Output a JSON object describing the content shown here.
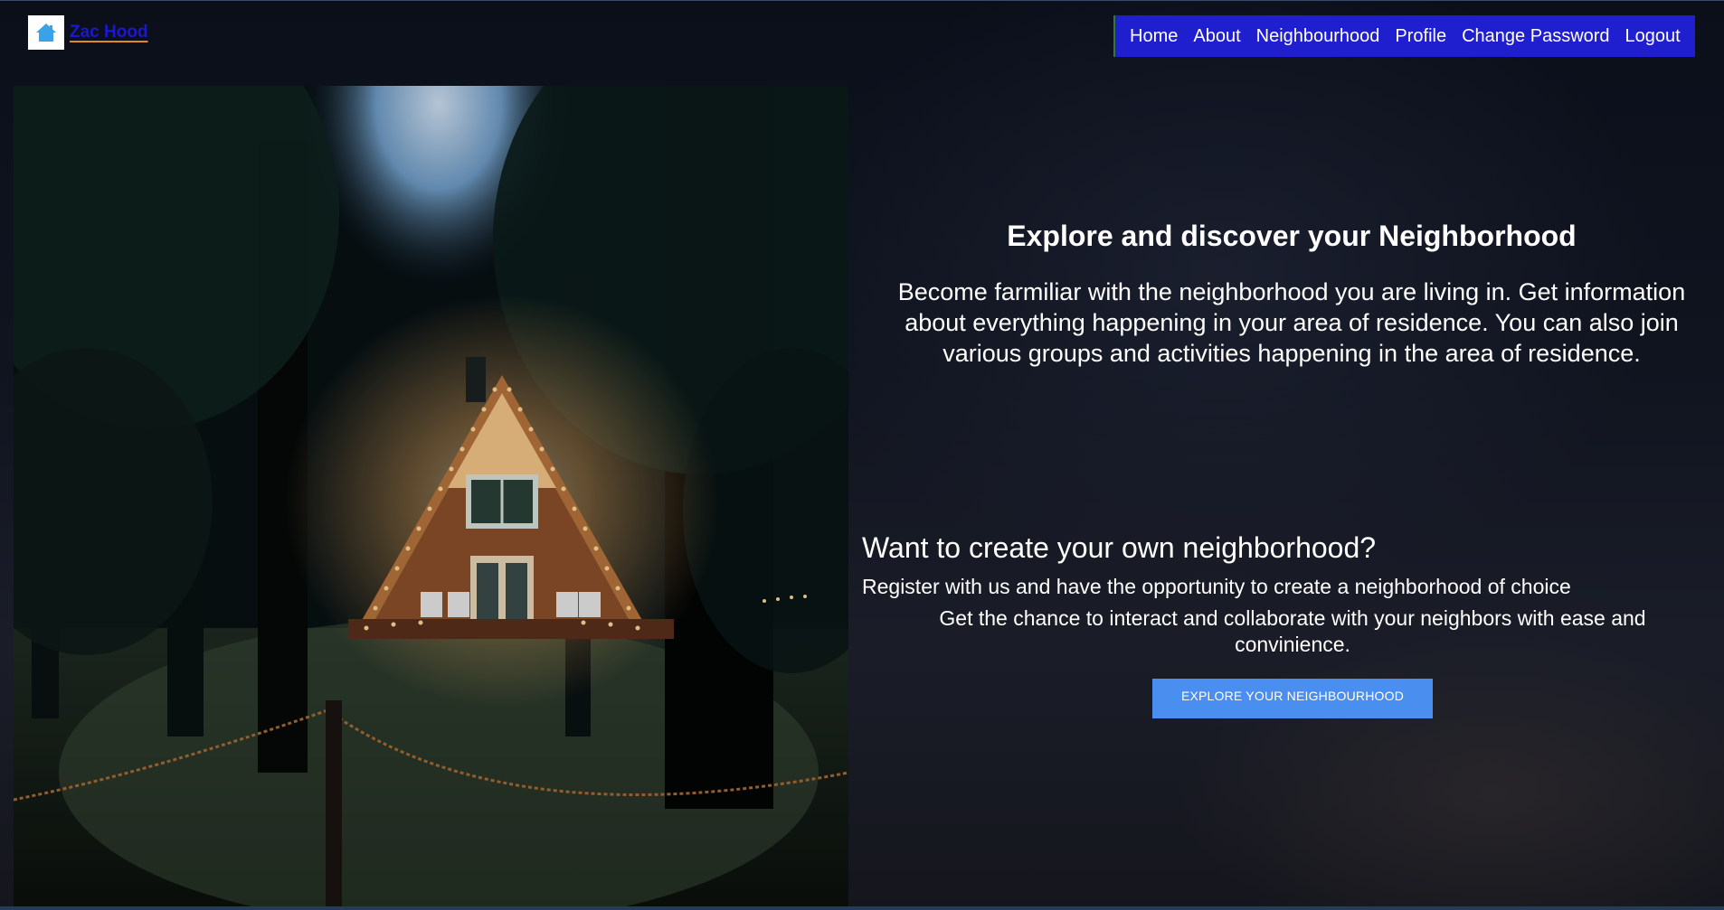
{
  "header": {
    "brand_name": "Zac Hood",
    "logo_icon": "house-icon"
  },
  "nav": {
    "items": [
      {
        "label": "Home"
      },
      {
        "label": "About"
      },
      {
        "label": "Neighbourhood"
      },
      {
        "label": "Profile"
      },
      {
        "label": "Change Password"
      },
      {
        "label": "Logout"
      }
    ]
  },
  "hero": {
    "headline": "Explore and discover your Neighborhood",
    "intro": "Become farmiliar with the neighborhood you are living in. Get information about everything happening in your area of residence. You can also join various groups and activities happening in the area of residence."
  },
  "cta": {
    "heading": "Want to create your own neighborhood?",
    "register_text": "Register with us and have the opportunity to create a neighborhood of choice",
    "interact_text": "Get the chance to interact and collaborate with your neighbors with ease and convinience.",
    "button_label": "EXPLORE YOUR NEIGHBOURHOOD"
  },
  "colors": {
    "nav_bg": "#1f1fcf",
    "brand_link": "#1a17d6",
    "brand_underline": "#e08b1f",
    "button_bg": "#4a8ef0",
    "page_bg": "#0d1220"
  }
}
